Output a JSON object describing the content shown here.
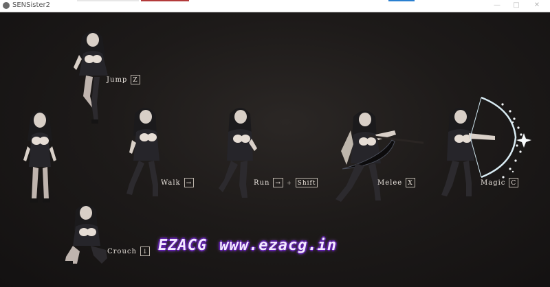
{
  "window": {
    "title": "SENSister2"
  },
  "controls": [
    {
      "action": "Jump",
      "key": "Z"
    },
    {
      "action": "Walk",
      "key": "→"
    },
    {
      "action": "Run",
      "key": "→",
      "key2": "Shift"
    },
    {
      "action": "Melee",
      "key": "X"
    },
    {
      "action": "Magic",
      "key": "C"
    },
    {
      "action": "Crouch",
      "key": "↓"
    }
  ],
  "watermark": {
    "brand": "EZACG",
    "url": "www.ezacg.in"
  },
  "icons": {
    "window_controls": [
      "minimize-icon",
      "maximize-icon",
      "close-icon"
    ]
  }
}
